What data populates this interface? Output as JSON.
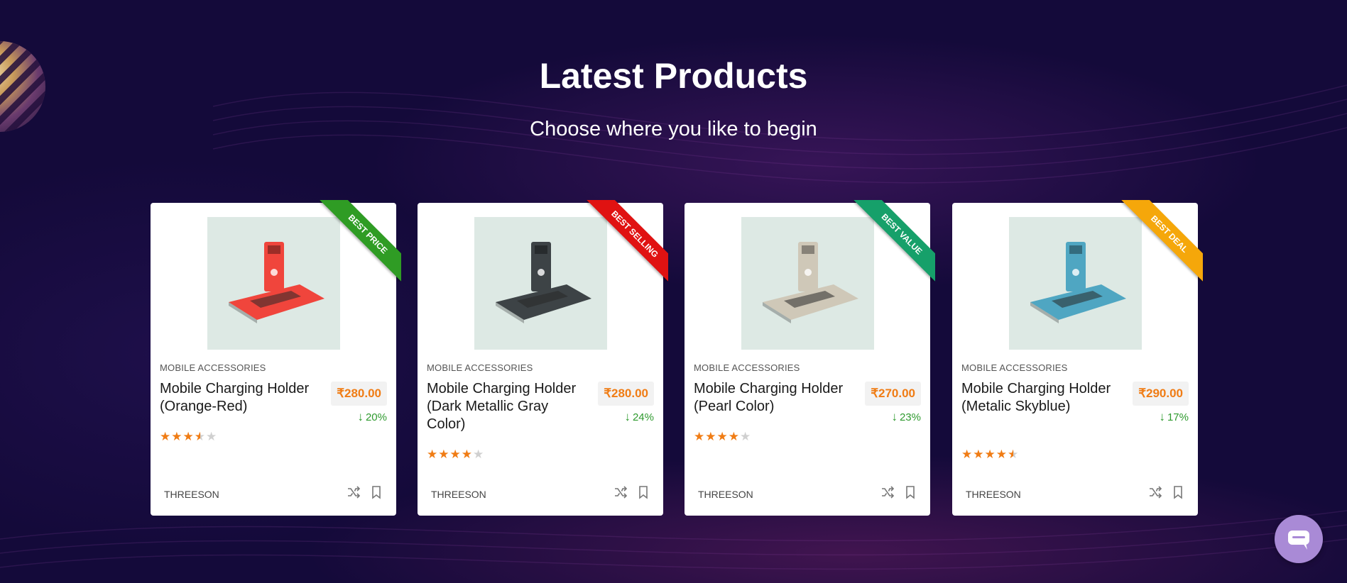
{
  "section": {
    "title": "Latest Products",
    "subtitle": "Choose where you like to begin"
  },
  "products": [
    {
      "badge": "BEST PRICE",
      "badge_color": "#2f9c24",
      "product_color": "#f0453c",
      "category": "MOBILE ACCESSORIES",
      "title": "Mobile Charging Holder (Orange-Red)",
      "price": "₹280.00",
      "discount": "20%",
      "rating": 3.5,
      "brand": "THREESON"
    },
    {
      "badge": "BEST SELLING",
      "badge_color": "#e01212",
      "product_color": "#3d4346",
      "category": "MOBILE ACCESSORIES",
      "title": "Mobile Charging Holder (Dark Metallic Gray Color)",
      "price": "₹280.00",
      "discount": "24%",
      "rating": 4,
      "brand": "THREESON"
    },
    {
      "badge": "BEST VALUE",
      "badge_color": "#16a06a",
      "product_color": "#cfc8b8",
      "category": "MOBILE ACCESSORIES",
      "title": "Mobile Charging Holder (Pearl Color)",
      "price": "₹270.00",
      "discount": "23%",
      "rating": 4,
      "brand": "THREESON"
    },
    {
      "badge": "BEST DEAL",
      "badge_color": "#f5a70a",
      "product_color": "#4fa6c2",
      "category": "MOBILE ACCESSORIES",
      "title": "Mobile Charging Holder (Metalic Skyblue)",
      "price": "₹290.00",
      "discount": "17%",
      "rating": 4.5,
      "brand": "THREESON"
    }
  ],
  "icons": {
    "compare": "shuffle-icon",
    "wishlist": "bookmark-icon",
    "chat": "chat-bubble-icon"
  },
  "colors": {
    "background": "#140a3a",
    "price": "#f07c14",
    "discount": "#2e9a2e",
    "chat": "#a98ad6"
  }
}
